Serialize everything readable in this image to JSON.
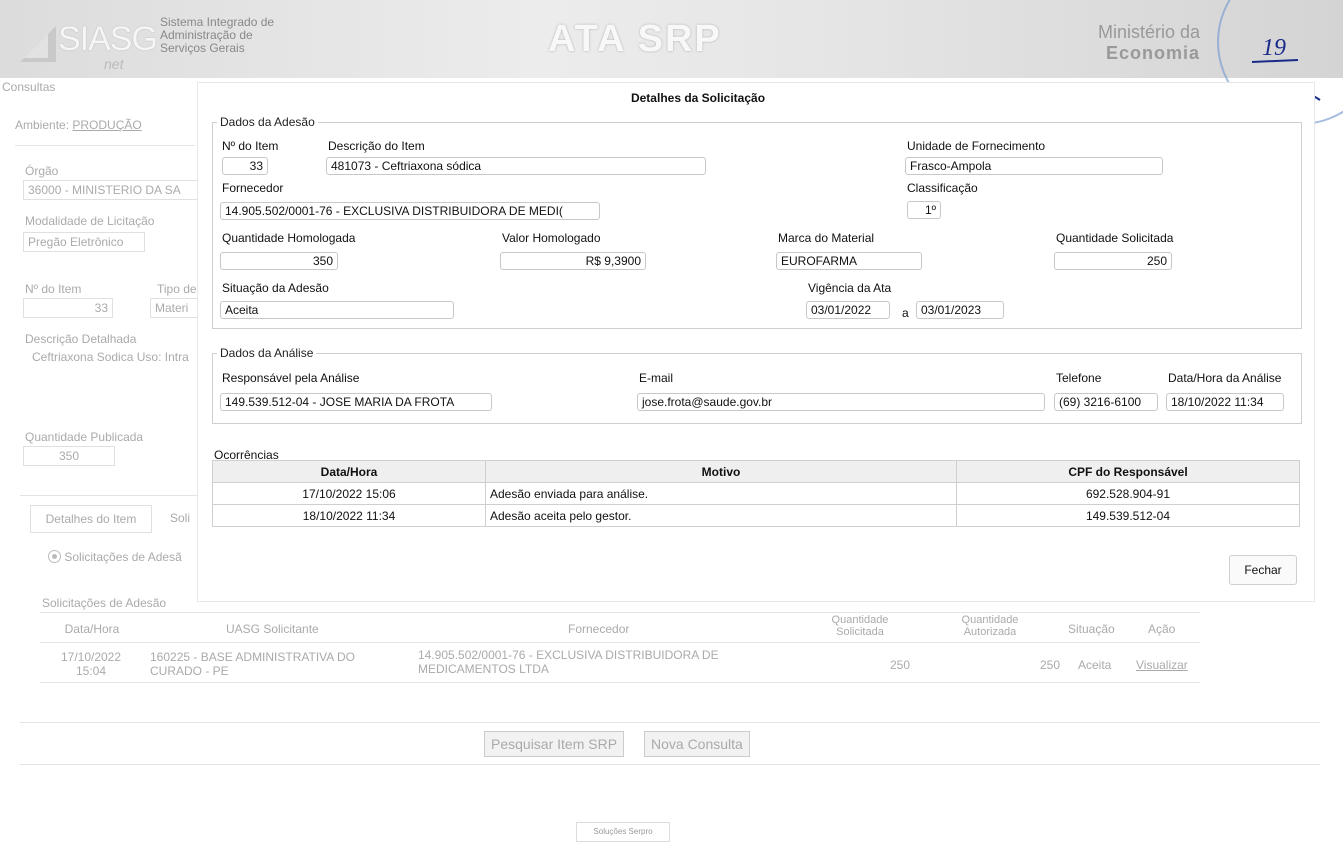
{
  "header": {
    "logo": "SIASG",
    "logo_suffix": "net",
    "system_name": [
      "Sistema Integrado de",
      "Administração de",
      "Serviços Gerais"
    ],
    "app_title": "ATA SRP",
    "ministry_line1": "Ministério da",
    "ministry_line2": "Economia",
    "stamp_number": "19"
  },
  "background": {
    "menu": "Consultas",
    "ambiente_label": "Ambiente:",
    "ambiente_value": "PRODUÇÃO",
    "orgao_label": "Órgão",
    "orgao_value": "36000 - MINISTERIO DA SA",
    "modalidade_label": "Modalidade de Licitação",
    "modalidade_value": "Pregão Eletrônico",
    "item_label": "Nº do Item",
    "item_value": "33",
    "tipo_label": "Tipo de",
    "tipo_value": "Materi",
    "descricao_label": "Descrição Detalhada",
    "descricao_value": "Ceftriaxona Sodica Uso: Intra",
    "qtd_pub_label": "Quantidade Publicada",
    "qtd_pub_value": "350",
    "tab1": "Detalhes do Item",
    "tab2": "Soli",
    "radio_label": "Solicitações de Adesã",
    "section_label": "Solicitações de Adesão",
    "table_headers": [
      "Data/Hora",
      "UASG Solicitante",
      "Fornecedor",
      "Quantidade Solicitada",
      "Quantidade Autorizada",
      "Situação",
      "Ação"
    ],
    "row": {
      "data": "17/10/2022 15:04",
      "uasg": "160225 - BASE ADMINISTRATIVA DO CURADO - PE",
      "fornecedor": "14.905.502/0001-76 - EXCLUSIVA DISTRIBUIDORA DE MEDICAMENTOS LTDA",
      "qtd_sol": "250",
      "qtd_aut": "250",
      "situacao": "Aceita",
      "acao": "Visualizar"
    },
    "btn_pesquisar": "Pesquisar Item SRP",
    "btn_nova": "Nova Consulta",
    "footer": "Soluções Serpro"
  },
  "modal": {
    "title": "Detalhes da Solicitação",
    "adesao": {
      "legend": "Dados da Adesão",
      "item_label": "Nº do Item",
      "item_value": "33",
      "descricao_label": "Descrição do Item",
      "descricao_value": "481073 - Ceftriaxona sódica",
      "unidade_label": "Unidade de Fornecimento",
      "unidade_value": "Frasco-Ampola",
      "fornecedor_label": "Fornecedor",
      "fornecedor_value": "14.905.502/0001-76 - EXCLUSIVA DISTRIBUIDORA DE MEDI(",
      "classificacao_label": "Classificação",
      "classificacao_value": "1º",
      "qtd_hom_label": "Quantidade Homologada",
      "qtd_hom_value": "350",
      "valor_label": "Valor Homologado",
      "valor_value": "R$ 9,3900",
      "marca_label": "Marca do Material",
      "marca_value": "EUROFARMA",
      "qtd_sol_label": "Quantidade Solicitada",
      "qtd_sol_value": "250",
      "situacao_label": "Situação da Adesão",
      "situacao_value": "Aceita",
      "vigencia_label": "Vigência da Ata",
      "vigencia_inicio": "03/01/2022",
      "vigencia_sep": "a",
      "vigencia_fim": "03/01/2023"
    },
    "analise": {
      "legend": "Dados da Análise",
      "responsavel_label": "Responsável pela Análise",
      "responsavel_value": "149.539.512-04 - JOSE MARIA DA FROTA",
      "email_label": "E-mail",
      "email_value": "jose.frota@saude.gov.br",
      "telefone_label": "Telefone",
      "telefone_value": "(69) 3216-6100",
      "data_label": "Data/Hora da Análise",
      "data_value": "18/10/2022 11:34"
    },
    "ocorrencias": {
      "label": "Ocorrências",
      "headers": [
        "Data/Hora",
        "Motivo",
        "CPF do Responsável"
      ],
      "rows": [
        {
          "data": "17/10/2022 15:06",
          "motivo": "Adesão enviada para análise.",
          "cpf": "692.528.904-91"
        },
        {
          "data": "18/10/2022 11:34",
          "motivo": "Adesão aceita pelo gestor.",
          "cpf": "149.539.512-04"
        }
      ]
    },
    "close_label": "Fechar"
  }
}
